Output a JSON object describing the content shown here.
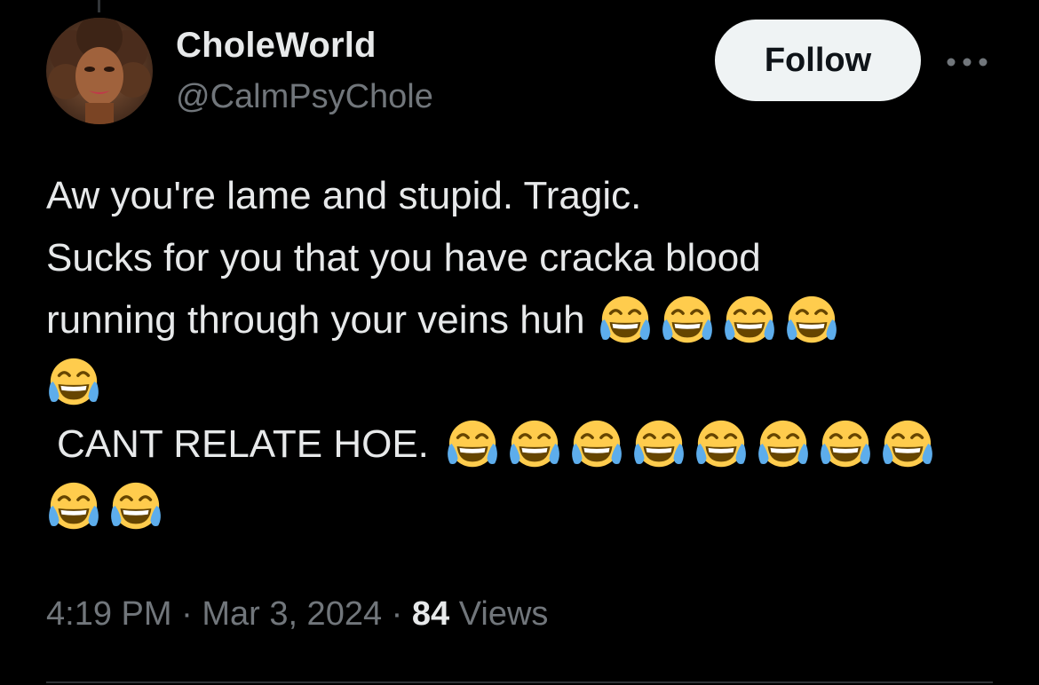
{
  "author": {
    "display_name": "CholeWorld",
    "handle": "@CalmPsyChole",
    "avatar_icon": "profile-photo"
  },
  "actions": {
    "follow_label": "Follow",
    "more_icon": "more-horizontal-icon"
  },
  "tweet": {
    "lines": [
      "Aw you're lame and stupid. Tragic.",
      "Sucks for you that you have cracka blood",
      "running through your veins huh",
      "CANT RELATE HOE."
    ],
    "emoji_icon": "face-with-tears-of-joy"
  },
  "meta": {
    "time": "4:19 PM",
    "separator": "·",
    "date": "Mar 3, 2024",
    "views_count": "84",
    "views_label": "Views"
  },
  "colors": {
    "background": "#000000",
    "text_primary": "#e7e9ea",
    "text_secondary": "#71767b",
    "button_bg": "#eff3f4",
    "button_text": "#0f1419"
  }
}
